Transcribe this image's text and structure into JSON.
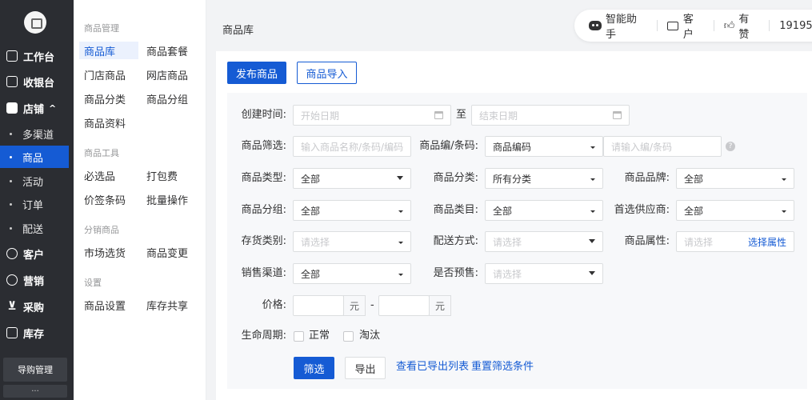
{
  "nav": {
    "items": [
      {
        "label": "工作台"
      },
      {
        "label": "收银台"
      },
      {
        "label": "店铺",
        "arrow": "^"
      },
      {
        "label": "多渠道"
      },
      {
        "label": "商品"
      },
      {
        "label": "活动"
      },
      {
        "label": "订单"
      },
      {
        "label": "配送"
      },
      {
        "label": "客户"
      },
      {
        "label": "营销"
      },
      {
        "label": "采购"
      },
      {
        "label": "库存"
      }
    ],
    "guide_label": "导购管理",
    "more_label": "···"
  },
  "subnav": {
    "groups": [
      {
        "title": "商品管理",
        "items": [
          "商品库",
          "商品套餐",
          "门店商品",
          "网店商品",
          "商品分类",
          "商品分组",
          "商品资料"
        ]
      },
      {
        "title": "商品工具",
        "items": [
          "必选品",
          "打包费",
          "价签条码",
          "批量操作"
        ]
      },
      {
        "title": "分销商品",
        "items": [
          "市场选货",
          "商品变更"
        ]
      },
      {
        "title": "设置",
        "items": [
          "商品设置",
          "库存共享"
        ]
      }
    ]
  },
  "header": {
    "breadcrumb": "商品库",
    "assistant": "智能助手",
    "customer": "客户",
    "like": "有赞",
    "account": "19195..."
  },
  "actions": {
    "publish": "发布商品",
    "import": "商品导入"
  },
  "filters": {
    "create_time_label": "创建时间:",
    "start_date_placeholder": "开始日期",
    "to": "至",
    "end_date_placeholder": "结束日期",
    "product_filter_label": "商品筛选:",
    "product_filter_placeholder": "输入商品名称/条码/编码",
    "code_label": "商品编/条码:",
    "code_type": "商品编码",
    "code_placeholder": "请输入编/条码",
    "type_label": "商品类型:",
    "type_value": "全部",
    "category_label": "商品分类:",
    "category_value": "所有分类",
    "brand_label": "商品品牌:",
    "brand_value": "全部",
    "group_label": "商品分组:",
    "group_value": "全部",
    "class_label": "商品类目:",
    "class_value": "全部",
    "supplier_label": "首选供应商:",
    "supplier_value": "全部",
    "stock_label": "存货类别:",
    "stock_placeholder": "请选择",
    "delivery_label": "配送方式:",
    "delivery_placeholder": "请选择",
    "attr_label": "商品属性:",
    "attr_placeholder": "请选择",
    "attr_link": "选择属性",
    "channel_label": "销售渠道:",
    "channel_value": "全部",
    "presale_label": "是否预售:",
    "presale_placeholder": "请选择",
    "price_label": "价格:",
    "price_unit": "元",
    "price_dash": "-",
    "lifecycle_label": "生命周期:",
    "lifecycle_normal": "正常",
    "lifecycle_out": "淘汰"
  },
  "footer": {
    "filter": "筛选",
    "export": "导出",
    "view_exports": "查看已导出列表",
    "reset": "重置筛选条件"
  },
  "colors": {
    "primary": "#155bd4",
    "sidebar": "#2b2d32"
  }
}
